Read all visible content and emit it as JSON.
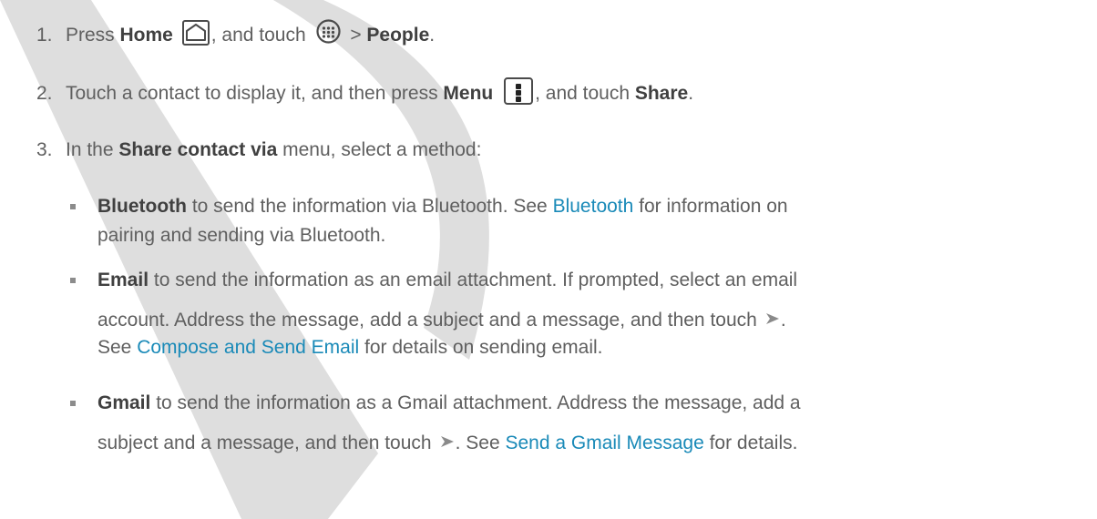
{
  "steps": [
    {
      "number": "1.",
      "press": "Press ",
      "home": "Home",
      "mid": ", and touch",
      "sep": " > ",
      "people": "People",
      "end": ".",
      "home_icon": "home-icon",
      "apps_icon": "apps-icon"
    },
    {
      "number": "2.",
      "t1": "Touch a contact to display it, and then press ",
      "menu": "Menu",
      "t2": ", and touch ",
      "share": "Share",
      "end": ".",
      "menu_icon": "menu-icon"
    },
    {
      "number": "3.",
      "t1": "In the ",
      "share_via": "Share contact via",
      "t2": " menu, select a method:"
    }
  ],
  "methods": [
    {
      "label": "Bluetooth",
      "l1a": " to send the information via Bluetooth. See ",
      "link": "Bluetooth",
      "l1b": " for information on",
      "l2": "pairing and sending via Bluetooth."
    },
    {
      "label": "Email",
      "l1": " to send the information as an email attachment. If prompted, select an email",
      "l2": "account. Address the message, add a subject and a message, and then touch",
      "l2end": ".",
      "l3a": "See ",
      "link": "Compose and Send Email",
      "l3b": " for details on sending email.",
      "send_icon": "send-icon"
    },
    {
      "label": "Gmail",
      "l1": " to send the information as a Gmail attachment. Address the message, add a",
      "l2a": "subject and a message, and then touch",
      "l2b": ". See ",
      "link": "Send a Gmail Message",
      "l2c": " for details.",
      "send_icon": "send-icon"
    }
  ],
  "colors": {
    "text": "#5f5f5f",
    "bold": "#404040",
    "link": "#1a8ab8",
    "watermark": "#dcdcdc"
  }
}
